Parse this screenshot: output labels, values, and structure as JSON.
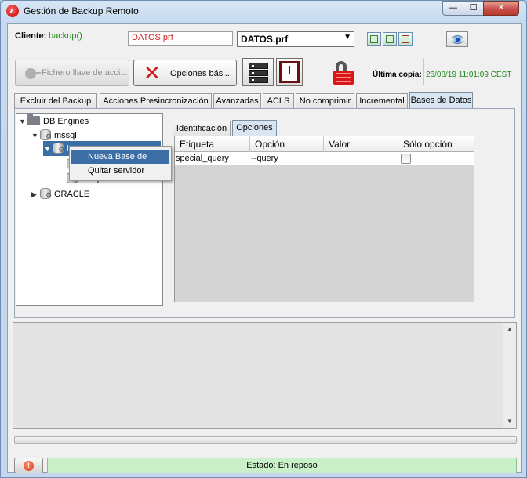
{
  "window": {
    "title": "Gestión de Backup Remoto",
    "controls": {
      "minimize": "—",
      "maximize": "☐",
      "close": "✕"
    }
  },
  "client_row": {
    "cliente_label": "Cliente:",
    "cliente_value": "backup()",
    "file_value": "DATOS.prf",
    "profile_selected": "DATOS.prf"
  },
  "toolbar": {
    "key_button_label": "Fichero llave de acci...",
    "options_button_label": "Opciones bási...",
    "last_copy_label": "Última copia:",
    "last_copy_value": "26/08/19 11:01:09 CEST"
  },
  "tabs": [
    {
      "label": "Excluir del Backup",
      "active": false
    },
    {
      "label": "Acciones Presincronización",
      "active": false
    },
    {
      "label": "Avanzadas",
      "active": false
    },
    {
      "label": "ACLS",
      "active": false
    },
    {
      "label": "No comprimir",
      "active": false
    },
    {
      "label": "Incremental",
      "active": false
    },
    {
      "label": "Bases de Datos",
      "active": true
    }
  ],
  "tree": {
    "root": "DB Engines",
    "mssql": "mssql",
    "local": "loc",
    "child_a": "",
    "child_b": "campus",
    "oracle": "ORACLE"
  },
  "context_menu": {
    "items": [
      "Nueva Base de Datos",
      "Quitar servidor"
    ]
  },
  "subtabs": [
    {
      "label": "Identificación",
      "active": false
    },
    {
      "label": "Opciones",
      "active": true
    }
  ],
  "options_grid": {
    "headers": [
      "Etiqueta",
      "Opción",
      "Valor",
      "Sólo opción"
    ],
    "rows": [
      {
        "etiqueta": "special_query",
        "opcion": "--query",
        "valor": "",
        "solo_opcion": false
      }
    ]
  },
  "status": {
    "text": "Estado: En reposo"
  },
  "colors": {
    "accent_green": "#1a8a1a",
    "file_red": "#cc2222",
    "selection_blue": "#3a6ea5",
    "status_bg": "#c9f0c9"
  }
}
